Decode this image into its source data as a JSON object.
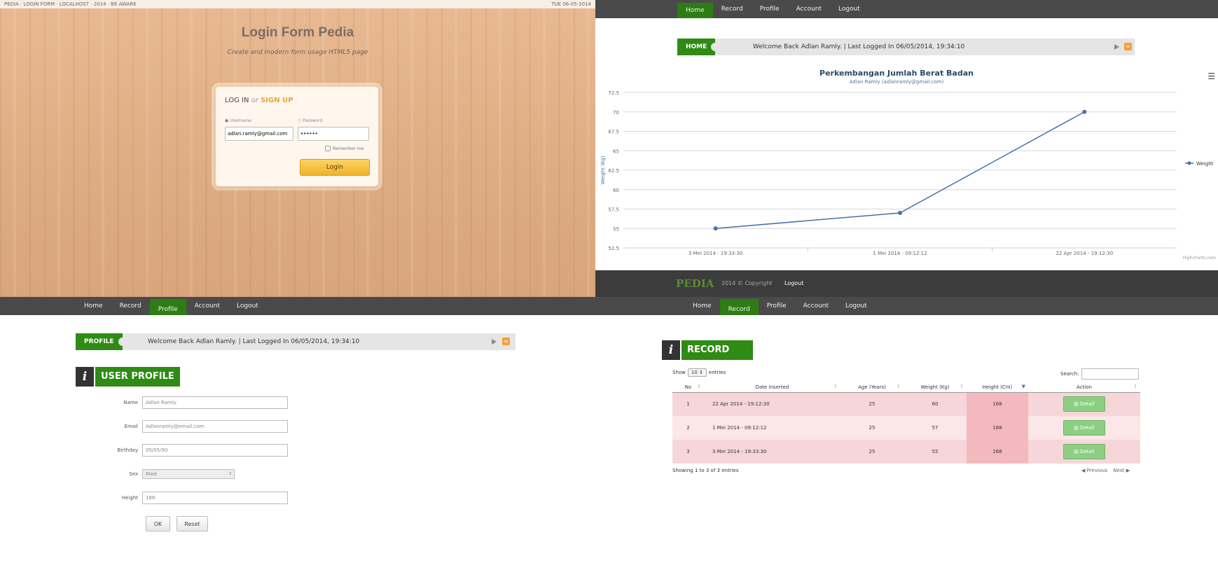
{
  "login": {
    "topbar_left": "PEDIA · LOGIN FORM · LOCALHOST · 2014 · BE AWARE",
    "topbar_right": "TUE 06-05-2014",
    "title": "Login Form Pedia",
    "subtitle": "Create and modern form usage HTML5 page",
    "heading_login": "LOG IN",
    "heading_or": "or",
    "heading_signup": "SIGN UP",
    "username_label": "Username",
    "password_label": "Password",
    "username_value": "adlan.ramly@gmail.com",
    "password_value": "••••••",
    "remember_label": "Remember me",
    "login_button": "Login"
  },
  "nav": {
    "items": [
      "Home",
      "Record",
      "Profile",
      "Account",
      "Logout"
    ]
  },
  "home": {
    "tag": "HOME",
    "message": "Welcome Back Adlan Ramly. | Last Logged In 06/05/2014, 19:34:10"
  },
  "chart_menu_icon": "hamburger-icon",
  "chart_data": {
    "type": "line",
    "title": "Perkembangan Jumlah Berat Badan",
    "subtitle": "Adlan Ramly (adlanramly@gmail.com)",
    "ylabel": "Weight (Kg)",
    "xlabel": "",
    "categories": [
      "3 Mei 2014 - 19:33:30",
      "1 Mei 2014 - 09:12:12",
      "22 Apr 2014 - 19:12:30"
    ],
    "series": [
      {
        "name": "Weight",
        "values": [
          55,
          57,
          70
        ],
        "color": "#4572A7"
      }
    ],
    "yticks": [
      52.5,
      55,
      57.5,
      60,
      62.5,
      65,
      67.5,
      70,
      72.5
    ],
    "ylim": [
      52.5,
      72.5
    ],
    "grid": true,
    "legend": "right",
    "credits": "Highcharts.com"
  },
  "footer": {
    "logo": "PEDIA",
    "text": "2014 © Copyright",
    "link": "Logout"
  },
  "profile": {
    "tag": "PROFILE",
    "message": "Welcome Back Adlan Ramly. | Last Logged In 06/05/2014, 19:34:10",
    "section_title": "USER PROFILE",
    "fields": [
      {
        "label": "Name",
        "value": "Adlan Ramly"
      },
      {
        "label": "Email",
        "value": "Adlanramly@email.com"
      },
      {
        "label": "Birthday",
        "value": "05/05/90"
      },
      {
        "label": "Sex",
        "value": "Male"
      },
      {
        "label": "Height",
        "value": "168"
      }
    ],
    "ok_button": "OK",
    "reset_button": "Reset"
  },
  "record": {
    "section_title": "RECORD",
    "show_label": "Show",
    "show_value": "10",
    "entries_label": "entries",
    "search_label": "Search:",
    "columns": [
      "No",
      "Date Inserted",
      "Age (Years)",
      "Weight (Kg)",
      "Height (Cm)",
      "Action"
    ],
    "rows": [
      [
        "1",
        "22 Apr 2014 - 19:12:30",
        "25",
        "60",
        "168",
        "Detail"
      ],
      [
        "2",
        "1 Mei 2014 - 09:12:12",
        "25",
        "57",
        "168",
        "Detail"
      ],
      [
        "3",
        "3 Mei 2014 - 19:33:30",
        "25",
        "55",
        "168",
        "Detail"
      ]
    ],
    "info": "Showing 1 to 3 of 3 entries",
    "previous": "Previous",
    "next": "Next"
  }
}
